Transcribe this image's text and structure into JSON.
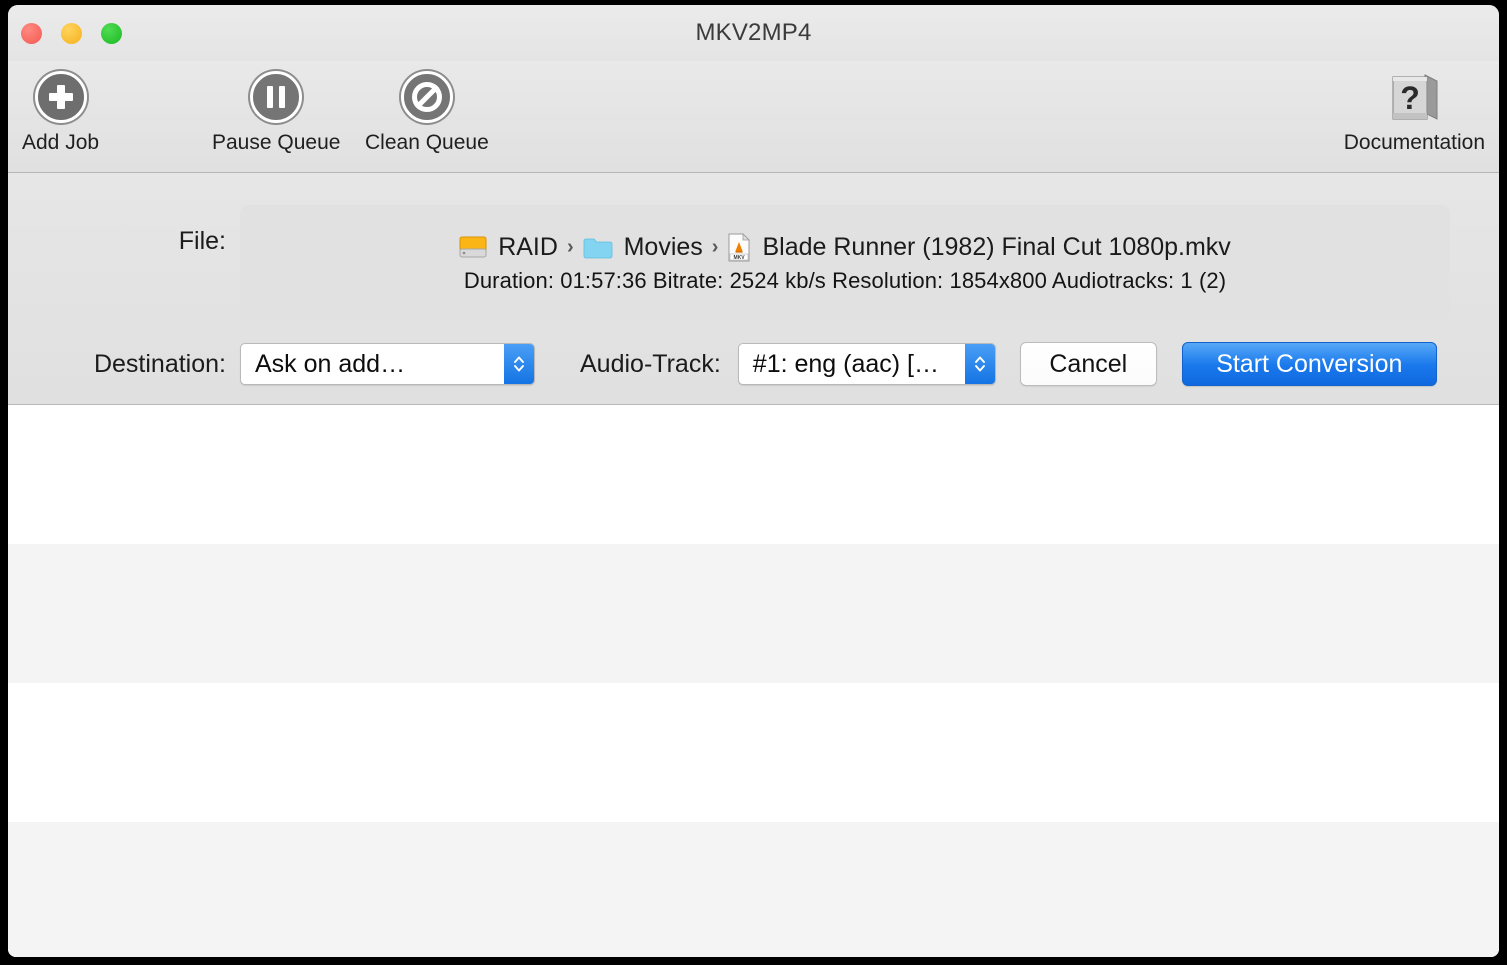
{
  "window": {
    "title": "MKV2MP4",
    "traffic_lights": [
      {
        "name": "close",
        "color": "#f4594f"
      },
      {
        "name": "minimize",
        "color": "#f5b01c"
      },
      {
        "name": "maximize",
        "color": "#1db824"
      }
    ]
  },
  "toolbar": {
    "items": [
      {
        "id": "add-job",
        "label": "Add Job",
        "icon": "plus-circle-icon"
      },
      {
        "id": "pause-queue",
        "label": "Pause Queue",
        "icon": "pause-circle-icon"
      },
      {
        "id": "clean-queue",
        "label": "Clean Queue",
        "icon": "prohibition-circle-icon"
      },
      {
        "id": "documentation",
        "label": "Documentation",
        "icon": "book-question-icon"
      }
    ]
  },
  "file_info": {
    "label": "File:",
    "breadcrumb": [
      {
        "name": "RAID",
        "icon": "hard-drive-icon"
      },
      {
        "name": "Movies",
        "icon": "folder-icon"
      },
      {
        "name": "Blade Runner (1982) Final Cut 1080p.mkv",
        "icon": "mkv-file-icon"
      }
    ],
    "separator": "›",
    "metadata": {
      "duration_label": "Duration:",
      "duration": "01:57:36",
      "bitrate_label": "Bitrate:",
      "bitrate": "2524 kb/s",
      "resolution_label": "Resolution:",
      "resolution": "1854x800",
      "audiotracks_label": "Audiotracks:",
      "audiotracks": "1 (2)",
      "full_line": "Duration: 01:57:36  Bitrate: 2524 kb/s  Resolution: 1854x800  Audiotracks: 1 (2)"
    }
  },
  "controls": {
    "destination": {
      "label": "Destination:",
      "value": "Ask on add…"
    },
    "audio_track": {
      "label": "Audio-Track:",
      "value": "#1: eng (aac) […"
    },
    "cancel_label": "Cancel",
    "start_label": "Start Conversion",
    "accent_color": "#1a79ec"
  },
  "queue": {
    "rows": [
      "",
      "",
      "",
      ""
    ]
  }
}
